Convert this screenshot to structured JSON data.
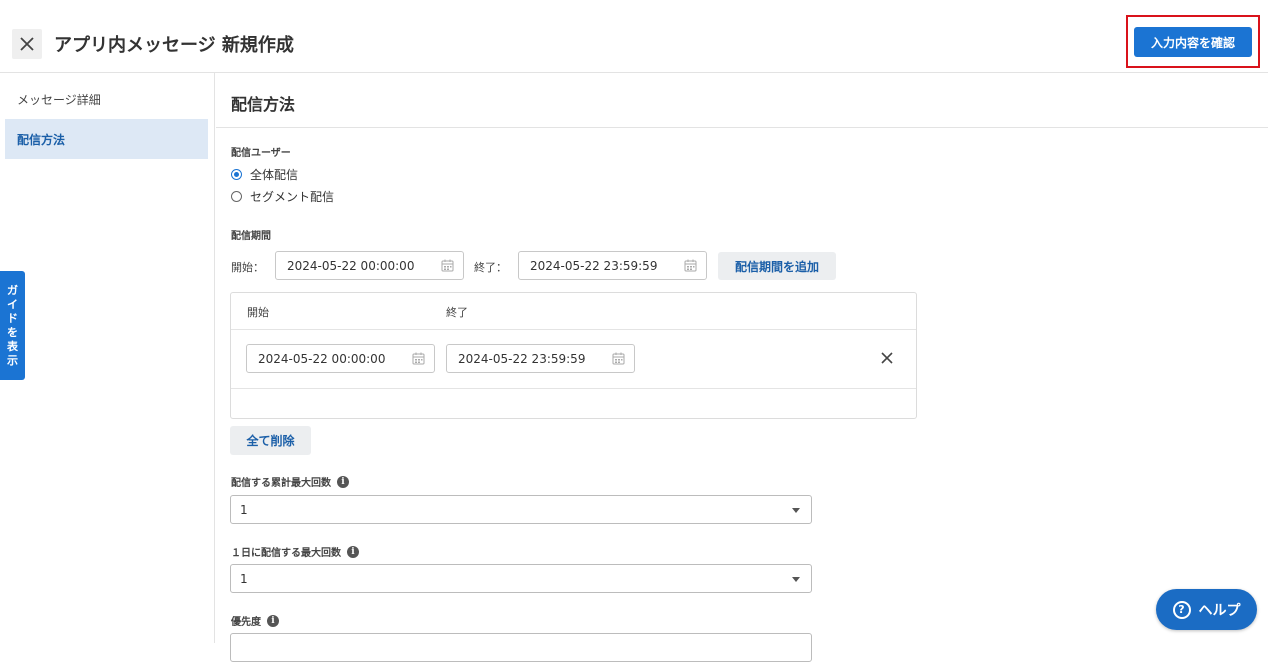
{
  "header": {
    "title": "アプリ内メッセージ 新規作成",
    "confirm_label": "入力内容を確認"
  },
  "sidebar": {
    "items": [
      {
        "label": "メッセージ詳細",
        "active": false
      },
      {
        "label": "配信方法",
        "active": true
      }
    ],
    "guide_tab_chars": [
      "ガ",
      "イ",
      "ド",
      "を",
      "表",
      "示"
    ]
  },
  "main": {
    "section_title": "配信方法",
    "delivery_users": {
      "label": "配信ユーザー",
      "options": [
        {
          "label": "全体配信",
          "checked": true
        },
        {
          "label": "セグメント配信",
          "checked": false
        }
      ]
    },
    "delivery_period": {
      "label": "配信期間",
      "start_label": "開始：",
      "end_label": "終了：",
      "start_value": "2024-05-22 00:00:00",
      "end_value": "2024-05-22 23:59:59",
      "add_label": "配信期間を追加",
      "table": {
        "head_start": "開始",
        "head_end": "終了",
        "rows": [
          {
            "start": "2024-05-22 00:00:00",
            "end": "2024-05-22 23:59:59"
          }
        ]
      },
      "delete_all_label": "全て削除"
    },
    "max_total": {
      "label": "配信する累計最大回数",
      "value": "1"
    },
    "max_daily": {
      "label": "１日に配信する最大回数",
      "value": "1"
    },
    "priority": {
      "label": "優先度"
    }
  },
  "help": {
    "label": "ヘルプ",
    "icon_glyph": "?"
  },
  "colors": {
    "accent": "#1b74d3",
    "highlight_frame": "#d9121b",
    "sidebar_active_bg": "#dde8f5"
  }
}
